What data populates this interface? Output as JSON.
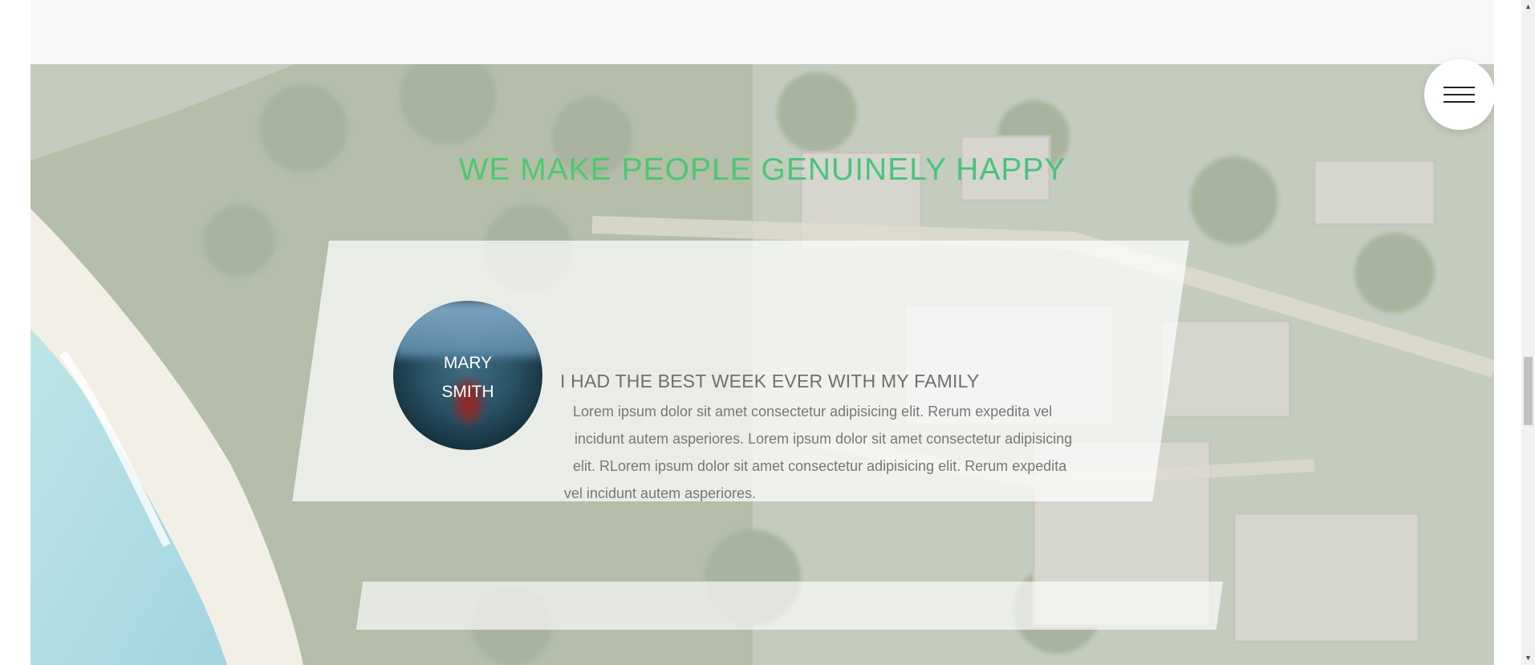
{
  "section": {
    "title": "WE MAKE PEOPLE GENUINELY HAPPY"
  },
  "testimonial": {
    "name_line_1": "MARY",
    "name_line_2": "SMITH",
    "title": "I HAD THE BEST WEEK EVER WITH MY FAMILY",
    "body_lines": [
      "Lorem ipsum dolor sit amet consectetur adipisicing elit. Rerum expedita vel",
      "incidunt autem asperiores. Lorem ipsum dolor sit amet consectetur adipisicing",
      "elit. RLorem ipsum dolor sit amet consectetur adipisicing elit. Rerum expedita",
      "vel incidunt autem asperiores."
    ]
  },
  "menu": {
    "icon": "hamburger-menu-icon"
  },
  "scrollbar": {
    "up_arrow": "▲",
    "down_arrow": "▼"
  },
  "colors": {
    "title_green": "#4cc771",
    "text_gray": "#777777",
    "heading_gray": "#6f6f6f",
    "top_band": "#f7f7f7"
  }
}
